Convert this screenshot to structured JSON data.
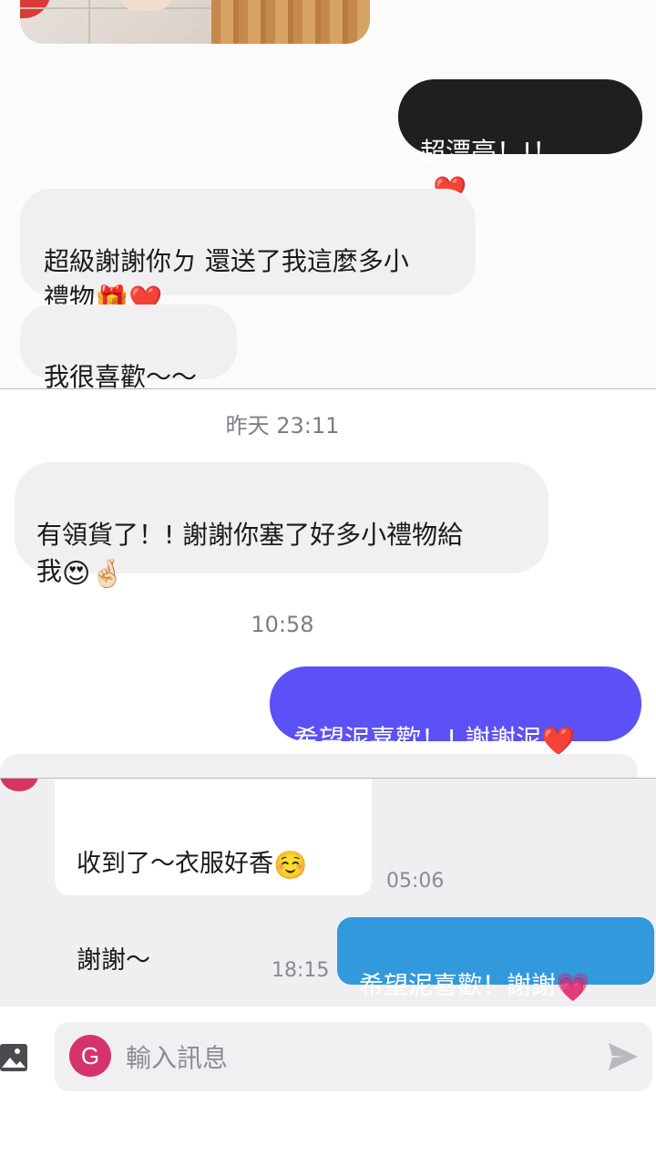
{
  "panel1": {
    "messages": [
      {
        "text": "超漂亮！!！",
        "emoji": "❤️"
      },
      {
        "text": "超級謝謝你ㄉ 還送了我這麼多小\n禮物",
        "emoji": "🎁❤️"
      },
      {
        "text": "我很喜歡～～"
      }
    ]
  },
  "panel2": {
    "time1": "昨天 23:11",
    "msg1": {
      "text": "有領貨了！!  謝謝你塞了好多小禮物給\n我",
      "emoji": "😍🤞🏻"
    },
    "time2": "10:58",
    "msg2": {
      "text": "希望泥喜歡！!  謝謝泥",
      "emoji": "❤️"
    }
  },
  "panel3": {
    "msg1": {
      "line1": "收到了～衣服好香",
      "emoji": "☺️",
      "line2": "謝謝～"
    },
    "time1": "05:06",
    "time2": "18:15",
    "msg2": {
      "text": "希望泥喜歡！謝謝",
      "emoji": "💗"
    },
    "input": {
      "avatar_letter": "G",
      "placeholder": "輸入訊息"
    }
  },
  "colors": {
    "purple_bubble": "#5b51f6",
    "blue_bubble": "#3399dd",
    "dark_bubble": "#1f1f1f",
    "avatar": "#d6336c"
  }
}
